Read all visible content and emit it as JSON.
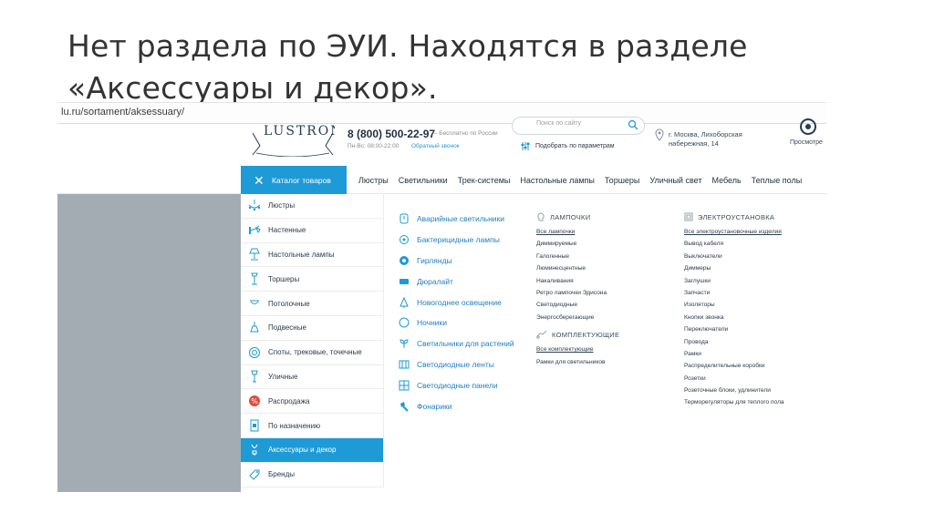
{
  "slide": {
    "title_line1": "Нет раздела по ЭУИ. Находятся в разделе",
    "title_line2": "«Аксессуары и декор»."
  },
  "browser": {
    "url": "lu.ru/sortament/aksessuary/"
  },
  "header": {
    "logo_text": "LUSTRON",
    "phone": "8 (800) 500-22-97",
    "phone_note": "— Бесплатно по России",
    "hours": "Пн-Вс: 08:00-22:00",
    "callback": "Обратный звонок",
    "search_placeholder": "Поиск по сайту",
    "params": "Подобрать по параметрам",
    "address_line1": "г. Москва, Лихоборская",
    "address_line2": "набережная, 14",
    "view_label": "Просмотре"
  },
  "nav": {
    "catalog": "Каталог товаров",
    "items": [
      "Люстры",
      "Светильники",
      "Трек-системы",
      "Настольные лампы",
      "Торшеры",
      "Уличный свет",
      "Мебель",
      "Теплые полы"
    ]
  },
  "sidebar": {
    "items": [
      {
        "label": "Люстры",
        "icon": "chandelier-icon"
      },
      {
        "label": "Настенные",
        "icon": "wall-lamp-icon"
      },
      {
        "label": "Настольные лампы",
        "icon": "table-lamp-icon"
      },
      {
        "label": "Торшеры",
        "icon": "floor-lamp-icon"
      },
      {
        "label": "Потолочные",
        "icon": "ceiling-lamp-icon"
      },
      {
        "label": "Подвесные",
        "icon": "pendant-lamp-icon"
      },
      {
        "label": "Споты, трековые, точечные",
        "icon": "spot-icon"
      },
      {
        "label": "Уличные",
        "icon": "street-lamp-icon"
      },
      {
        "label": "Распродажа",
        "icon": "sale-icon"
      },
      {
        "label": "По назначению",
        "icon": "purpose-icon"
      },
      {
        "label": "Аксессуары и декор",
        "icon": "accessories-icon"
      },
      {
        "label": "Бренды",
        "icon": "tag-icon"
      }
    ],
    "active_index": 10
  },
  "column1": {
    "items": [
      "Аварийные светильники",
      "Бактерицидные лампы",
      "Гирлянды",
      "Дюралайт",
      "Новогоднее освещение",
      "Ночники",
      "Светильники для растений",
      "Светодиодные ленты",
      "Светодиодные панели",
      "Фонарики"
    ]
  },
  "column2": {
    "bulbs_title": "ЛАМПОЧКИ",
    "bulbs": [
      "Все лампочки",
      "Диммируемые",
      "Галогенные",
      "Люминесцентные",
      "Накаливания",
      "Ретро лампочки Эдисона",
      "Светодиодные",
      "Энергосберегающие"
    ],
    "parts_title": "КОМПЛЕКТУЮЩИЕ",
    "parts": [
      "Все комплектующие",
      "Рамки для светильников"
    ]
  },
  "column3": {
    "title": "ЭЛЕКТРОУСТАНОВКА",
    "items": [
      "Все электроустановочные изделия",
      "Вывод кабеля",
      "Выключатели",
      "Диммеры",
      "Заглушки",
      "Запчасти",
      "Изоляторы",
      "Кнопки звонка",
      "Переключатели",
      "Провода",
      "Рамки",
      "Распределительные коробки",
      "Розетки",
      "Розеточные блоки, удлинители",
      "Терморегуляторы для теплого пола"
    ]
  },
  "colors": {
    "accent": "#1e9ad6",
    "gray_panel": "#a4acb3"
  }
}
